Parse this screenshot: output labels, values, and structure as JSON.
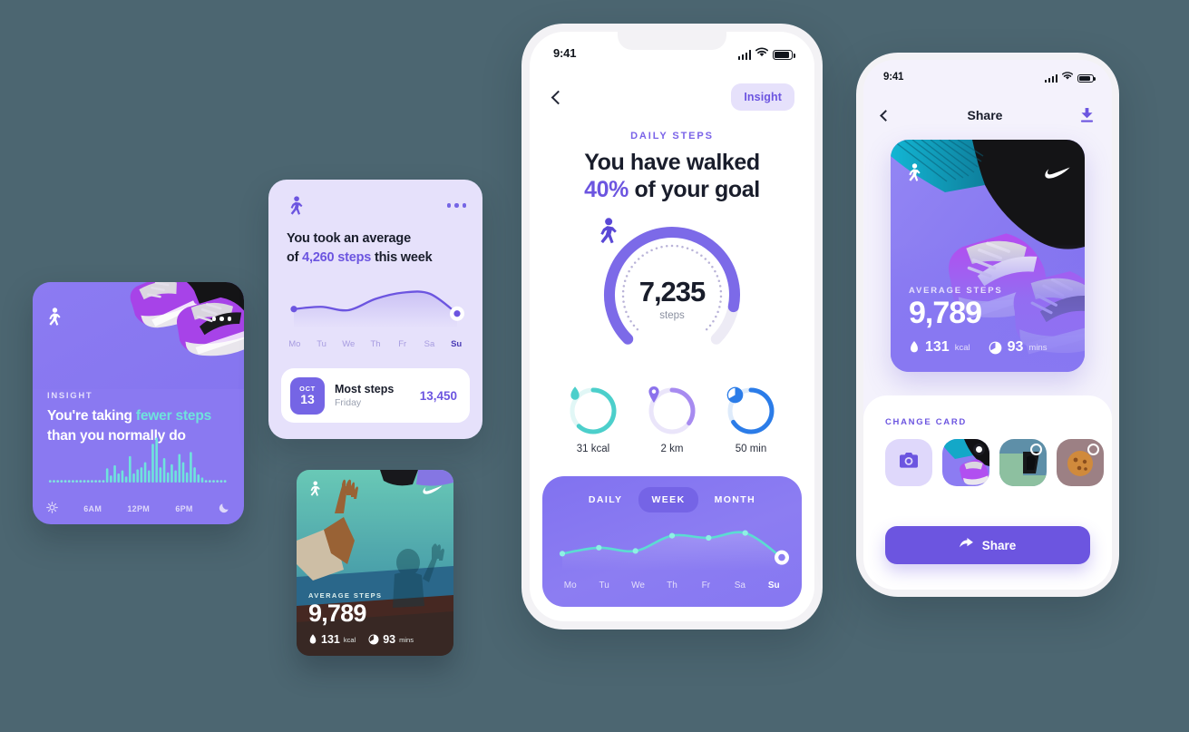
{
  "background_color": "#4C6671",
  "accent_purple": "#6C55E0",
  "accent_teal": "#5BDCD2",
  "phone_main": {
    "status": {
      "time": "9:41",
      "signal_icon": "cellular-bars-icon",
      "wifi_icon": "wifi-icon",
      "battery_icon": "battery-icon"
    },
    "nav": {
      "back_icon": "chevron-left-icon",
      "insight_label": "Insight"
    },
    "eyebrow": "DAILY STEPS",
    "headline_line1": "You have walked",
    "headline_accent": "40%",
    "headline_line2_rest": " of your goal",
    "gauge": {
      "value": "7,235",
      "unit": "steps",
      "icon": "walking-person-icon",
      "percent": 40,
      "track_color": "#EDEBF5",
      "arc_color": "#7C6AE8"
    },
    "metrics": [
      {
        "label": "31 kcal",
        "icon": "flame-icon",
        "color": "#4CCFCB",
        "track": "#E1F7F6",
        "pct": 62
      },
      {
        "label": "2 km",
        "icon": "pin-icon",
        "color": "#A78BF0",
        "track": "#EAE5FA",
        "pct": 35
      },
      {
        "label": "50 min",
        "icon": "clock-icon",
        "color": "#2B7CE8",
        "track": "#DEEBFB",
        "pct": 66
      }
    ],
    "chart": {
      "tabs": [
        {
          "label": "DAILY",
          "active": false
        },
        {
          "label": "WEEK",
          "active": true
        },
        {
          "label": "MONTH",
          "active": false
        }
      ],
      "days": [
        "Mo",
        "Tu",
        "We",
        "Th",
        "Fr",
        "Sa",
        "Su"
      ],
      "active_day": "Su"
    }
  },
  "phone_share": {
    "status": {
      "time": "9:41",
      "signal_icon": "cellular-bars-icon",
      "wifi_icon": "wifi-icon",
      "battery_icon": "battery-icon"
    },
    "nav": {
      "back_icon": "chevron-left-icon",
      "title": "Share",
      "download_icon": "download-icon"
    },
    "card": {
      "eyebrow": "AVERAGE STEPS",
      "value": "9,789",
      "stats": [
        {
          "icon": "flame-icon",
          "value": "131",
          "unit": "kcal"
        },
        {
          "icon": "clock-icon",
          "value": "93",
          "unit": "mins"
        }
      ],
      "logo_icon": "nike-swoosh-icon",
      "walk_icon": "walking-person-icon"
    },
    "sheet": {
      "eyebrow": "CHANGE CARD",
      "thumbnails": [
        {
          "name": "camera",
          "icon": "camera-icon",
          "selected": false
        },
        {
          "name": "sneakers-photo",
          "selected": true
        },
        {
          "name": "green-wall-photo",
          "selected": false
        },
        {
          "name": "cookie-photo",
          "selected": false
        }
      ],
      "share_button": {
        "label": "Share",
        "icon": "share-arrow-icon"
      }
    }
  },
  "card_insight": {
    "icon": "walking-person-icon",
    "menu_icon": "more-dots-icon",
    "eyebrow": "INSIGHT",
    "title_lead": "You're taking ",
    "title_accent": "fewer steps",
    "title_rest": "than you normally do",
    "axis": [
      "sun-icon",
      "6AM",
      "12PM",
      "6PM",
      "moon-icon"
    ],
    "axis_labels": [
      "6AM",
      "12PM",
      "6PM"
    ]
  },
  "card_week": {
    "icon": "walking-person-icon",
    "menu_icon": "more-dots-icon",
    "title_lead": "You took an average",
    "title_line2_lead": "of ",
    "title_accent": "4,260 steps",
    "title_rest": " this week",
    "days": [
      "Mo",
      "Tu",
      "We",
      "Th",
      "Fr",
      "Sa",
      "Su"
    ],
    "active_day": "Su",
    "row": {
      "month": "OCT",
      "day": "13",
      "title": "Most steps",
      "subtitle": "Friday",
      "value": "13,450"
    }
  },
  "card_photo": {
    "icon": "walking-person-icon",
    "logo_icon": "nike-swoosh-icon",
    "eyebrow": "AVERAGE STEPS",
    "value": "9,789",
    "stats": [
      {
        "icon": "flame-icon",
        "value": "131",
        "unit": "kcal"
      },
      {
        "icon": "clock-icon",
        "value": "93",
        "unit": "mins"
      }
    ]
  },
  "chart_data": [
    {
      "type": "line",
      "id": "main-week-steps",
      "title": "Weekly steps",
      "categories": [
        "Mo",
        "Tu",
        "We",
        "Th",
        "Fr",
        "Sa",
        "Su"
      ],
      "values": [
        3100,
        4200,
        3600,
        6400,
        6000,
        6900,
        2400
      ],
      "ylim": [
        0,
        8000
      ],
      "grid": true,
      "legend": "none",
      "line_color": "#5BDCD2",
      "highlight_index": 6
    },
    {
      "type": "line",
      "id": "card-week-steps",
      "title": "You took an average of 4,260 steps this week",
      "categories": [
        "Mo",
        "Tu",
        "We",
        "Th",
        "Fr",
        "Sa",
        "Su"
      ],
      "values": [
        3400,
        3800,
        3200,
        5200,
        6300,
        6100,
        2600
      ],
      "ylim": [
        0,
        8000
      ],
      "grid": true,
      "legend": "none",
      "line_color": "#6C55E0",
      "highlight_index": 6
    },
    {
      "type": "bar",
      "id": "insight-daily-activity",
      "title": "You're taking fewer steps than you normally do",
      "xlabel": "",
      "ylabel": "",
      "categories": [
        "6AM",
        "12PM",
        "6PM"
      ],
      "values": [
        0,
        0,
        0,
        0,
        0,
        0,
        0,
        0,
        0,
        0,
        0,
        0,
        0,
        0,
        0,
        14,
        7,
        17,
        9,
        12,
        6,
        26,
        9,
        13,
        15,
        20,
        12,
        38,
        44,
        15,
        24,
        10,
        18,
        12,
        28,
        20,
        10,
        30,
        15,
        8,
        5,
        0,
        0,
        0,
        0,
        0,
        0
      ],
      "bar_color": "#6FE3DC",
      "ylim": [
        0,
        48
      ],
      "grid": false
    },
    {
      "type": "gauge",
      "id": "daily-steps-gauge",
      "title": "DAILY STEPS",
      "value": 7235,
      "unit": "steps",
      "percent": 40,
      "arc_color": "#7C6AE8",
      "track_color": "#EDEBF5"
    },
    {
      "type": "gauge",
      "id": "metric-kcal",
      "value": 31,
      "unit": "kcal",
      "percent": 62,
      "arc_color": "#4CCFCB"
    },
    {
      "type": "gauge",
      "id": "metric-distance",
      "value": 2,
      "unit": "km",
      "percent": 35,
      "arc_color": "#A78BF0"
    },
    {
      "type": "gauge",
      "id": "metric-time",
      "value": 50,
      "unit": "min",
      "percent": 66,
      "arc_color": "#2B7CE8"
    }
  ]
}
